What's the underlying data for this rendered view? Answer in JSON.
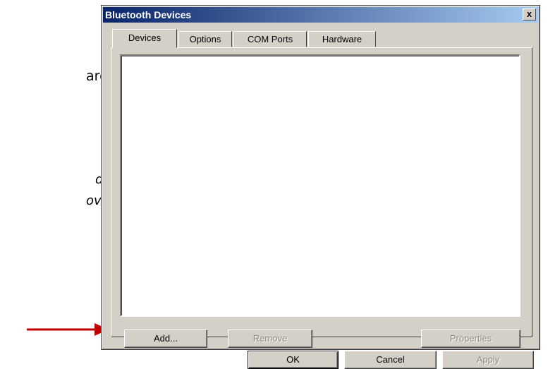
{
  "slide": {
    "line1": "ard.*",
    "line2": "d, be",
    "line3": "overable"
  },
  "window": {
    "title": "Bluetooth Devices",
    "close_label": "x"
  },
  "tabs": [
    {
      "label": "Devices",
      "active": true
    },
    {
      "label": "Options",
      "active": false
    },
    {
      "label": "COM Ports",
      "active": false
    },
    {
      "label": "Hardware",
      "active": false
    }
  ],
  "buttons": {
    "add": "Add...",
    "remove": "Remove",
    "properties": "Properties",
    "ok": "OK",
    "cancel": "Cancel",
    "apply": "Apply"
  },
  "colors": {
    "arrow": "#c00000",
    "titlebar": "#0a246a",
    "face": "#d4d0c8"
  },
  "icons": {
    "pointer": "arrow-icon"
  }
}
